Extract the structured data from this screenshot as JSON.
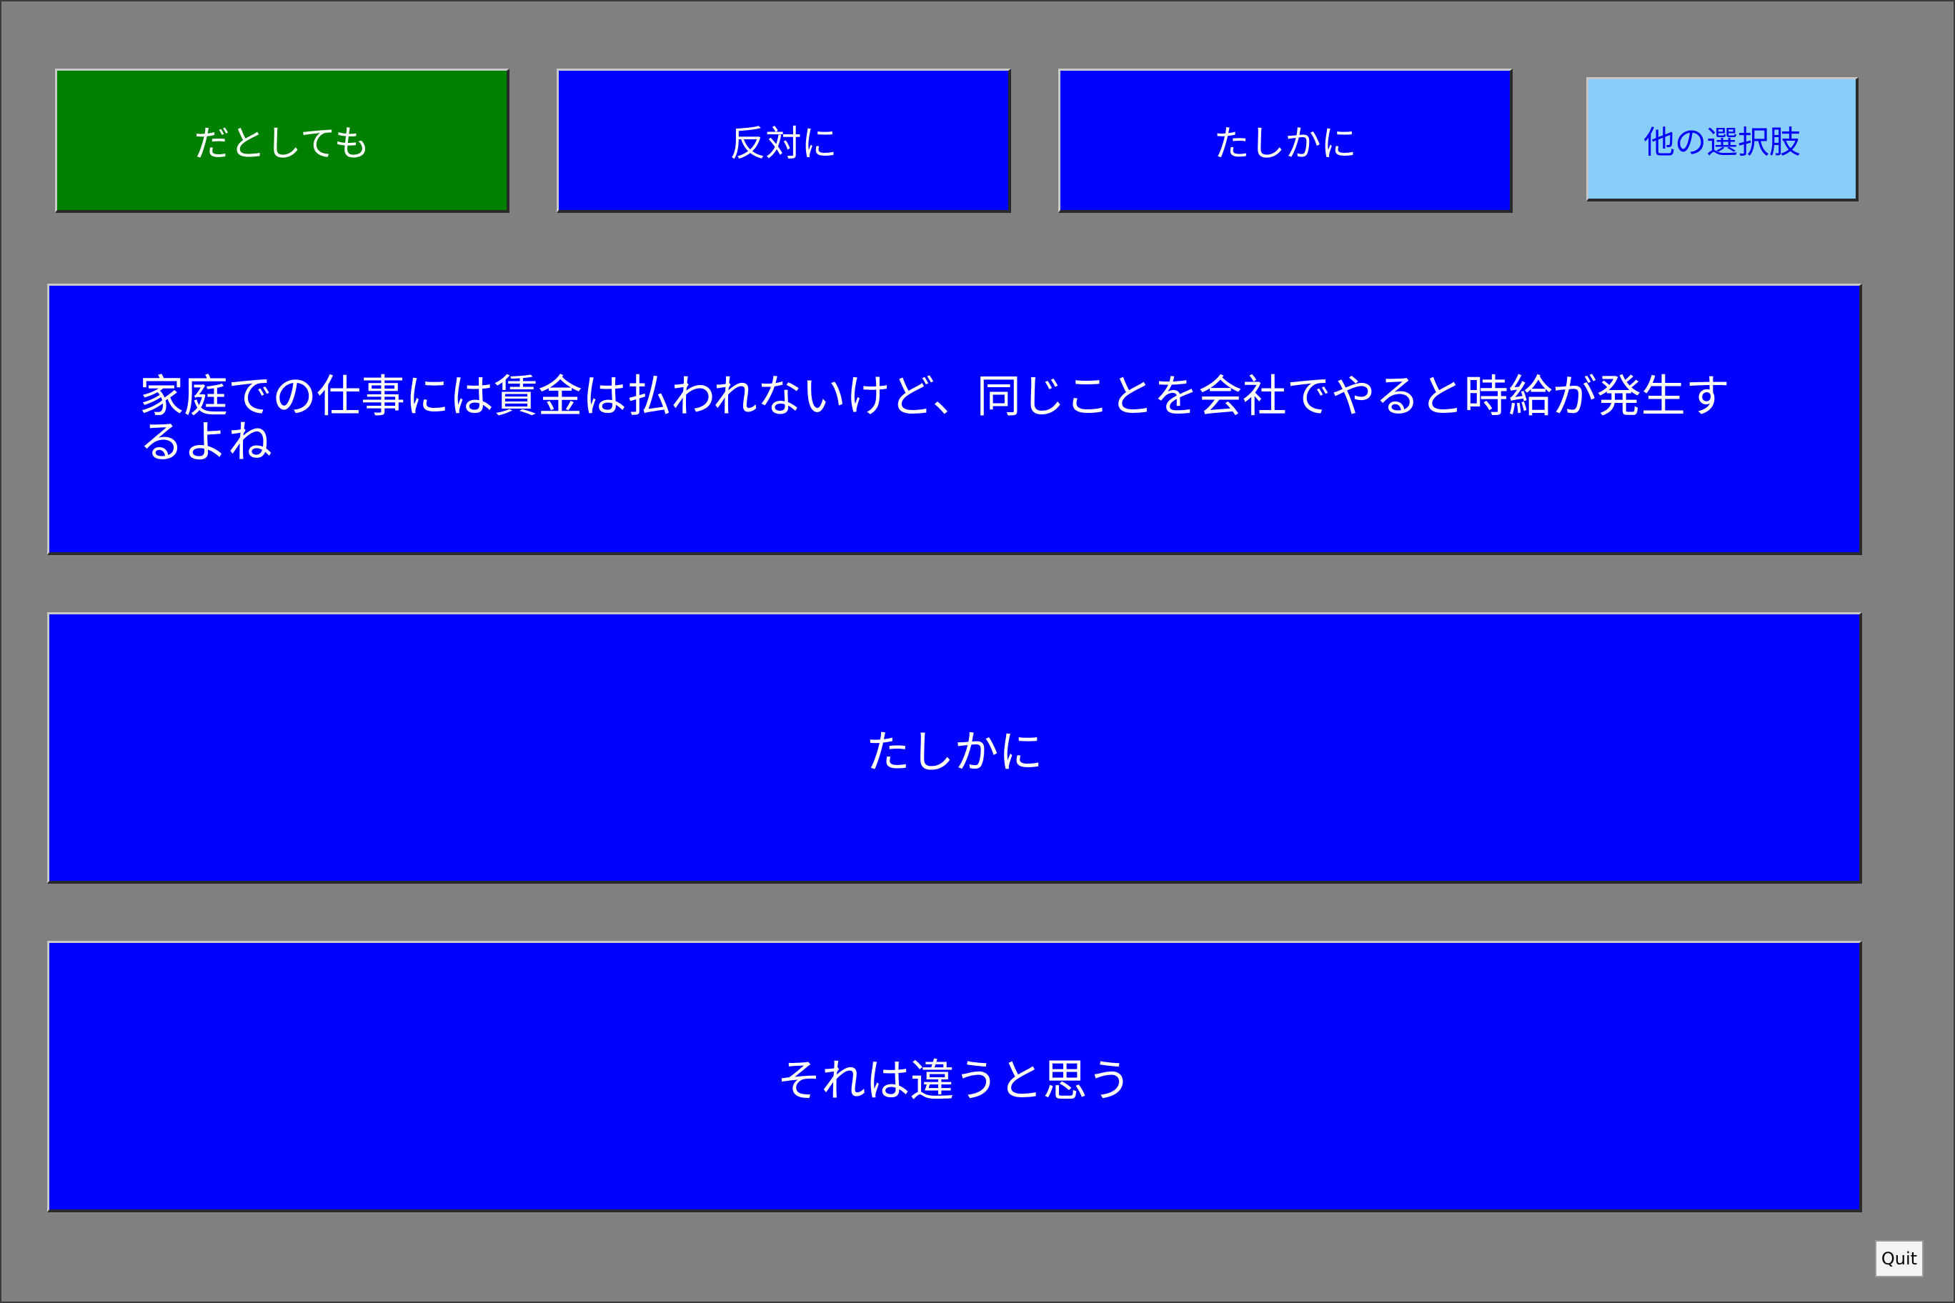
{
  "top_choices": {
    "choice_1": "だとしても",
    "choice_2": "反対に",
    "choice_3": "たしかに",
    "other_options": "他の選択肢"
  },
  "panels": {
    "prompt": "家庭での仕事には賃金は払われないけど、同じことを会社でやると時給が発生するよね",
    "option_1": "たしかに",
    "option_2": "それは違うと思う"
  },
  "quit_label": "Quit",
  "colors": {
    "background": "#808080",
    "selected": "#008000",
    "button": "#0000ff",
    "other_button": "#87cefa"
  }
}
